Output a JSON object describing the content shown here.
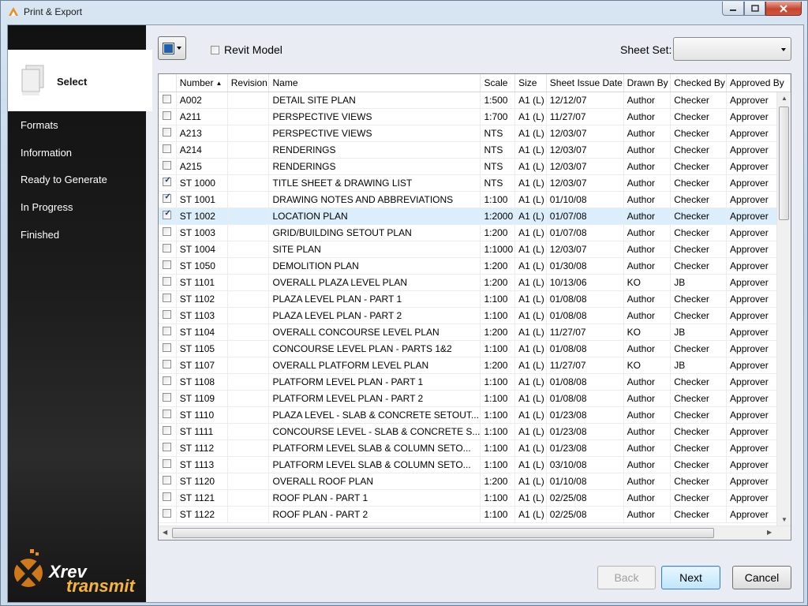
{
  "window": {
    "title": "Print & Export"
  },
  "sidebar": {
    "current_step": "Select",
    "steps": [
      "Formats",
      "Information",
      "Ready to Generate",
      "In Progress",
      "Finished"
    ],
    "logo": {
      "line1": "Xrev",
      "line2": "transmit"
    }
  },
  "toolbar": {
    "revit_model_label": "Revit Model",
    "revit_model_checked": false,
    "sheet_set_label": "Sheet Set:",
    "sheet_set_value": ""
  },
  "grid": {
    "columns": [
      "",
      "Number",
      "Revision",
      "Name",
      "Scale",
      "Size",
      "Sheet Issue Date",
      "Drawn By",
      "Checked By",
      "Approved By"
    ],
    "sort_column": "Number",
    "rows": [
      {
        "checked": false,
        "number": "A002",
        "revision": "",
        "name": "DETAIL SITE PLAN",
        "scale": "1:500",
        "size": "A1 (L)",
        "date": "12/12/07",
        "drawn": "Author",
        "checked_by": "Checker",
        "approved": "Approver"
      },
      {
        "checked": false,
        "number": "A211",
        "revision": "",
        "name": "PERSPECTIVE VIEWS",
        "scale": "1:700",
        "size": "A1 (L)",
        "date": "11/27/07",
        "drawn": "Author",
        "checked_by": "Checker",
        "approved": "Approver"
      },
      {
        "checked": false,
        "number": "A213",
        "revision": "",
        "name": "PERSPECTIVE VIEWS",
        "scale": "NTS",
        "size": "A1 (L)",
        "date": "12/03/07",
        "drawn": "Author",
        "checked_by": "Checker",
        "approved": "Approver"
      },
      {
        "checked": false,
        "number": "A214",
        "revision": "",
        "name": "RENDERINGS",
        "scale": "NTS",
        "size": "A1 (L)",
        "date": "12/03/07",
        "drawn": "Author",
        "checked_by": "Checker",
        "approved": "Approver"
      },
      {
        "checked": false,
        "number": "A215",
        "revision": "",
        "name": "RENDERINGS",
        "scale": "NTS",
        "size": "A1 (L)",
        "date": "12/03/07",
        "drawn": "Author",
        "checked_by": "Checker",
        "approved": "Approver"
      },
      {
        "checked": true,
        "number": "ST 1000",
        "revision": "",
        "name": "TITLE SHEET & DRAWING LIST",
        "scale": "NTS",
        "size": "A1 (L)",
        "date": "12/03/07",
        "drawn": "Author",
        "checked_by": "Checker",
        "approved": "Approver"
      },
      {
        "checked": true,
        "number": "ST 1001",
        "revision": "",
        "name": "DRAWING NOTES AND ABBREVIATIONS",
        "scale": "1:100",
        "size": "A1 (L)",
        "date": "01/10/08",
        "drawn": "Author",
        "checked_by": "Checker",
        "approved": "Approver"
      },
      {
        "checked": true,
        "selected": true,
        "number": "ST 1002",
        "revision": "",
        "name": "LOCATION PLAN",
        "scale": "1:2000",
        "size": "A1 (L)",
        "date": "01/07/08",
        "drawn": "Author",
        "checked_by": "Checker",
        "approved": "Approver"
      },
      {
        "checked": false,
        "number": "ST 1003",
        "revision": "",
        "name": "GRID/BUILDING SETOUT PLAN",
        "scale": "1:200",
        "size": "A1 (L)",
        "date": "01/07/08",
        "drawn": "Author",
        "checked_by": "Checker",
        "approved": "Approver"
      },
      {
        "checked": false,
        "number": "ST 1004",
        "revision": "",
        "name": "SITE PLAN",
        "scale": "1:1000",
        "size": "A1 (L)",
        "date": "12/03/07",
        "drawn": "Author",
        "checked_by": "Checker",
        "approved": "Approver"
      },
      {
        "checked": false,
        "number": "ST 1050",
        "revision": "",
        "name": "DEMOLITION PLAN",
        "scale": "1:200",
        "size": "A1 (L)",
        "date": "01/30/08",
        "drawn": "Author",
        "checked_by": "Checker",
        "approved": "Approver"
      },
      {
        "checked": false,
        "number": "ST 1101",
        "revision": "",
        "name": "OVERALL PLAZA LEVEL PLAN",
        "scale": "1:200",
        "size": "A1 (L)",
        "date": "10/13/06",
        "drawn": "KO",
        "checked_by": "JB",
        "approved": "Approver"
      },
      {
        "checked": false,
        "number": "ST 1102",
        "revision": "",
        "name": "PLAZA LEVEL PLAN - PART 1",
        "scale": "1:100",
        "size": "A1 (L)",
        "date": "01/08/08",
        "drawn": "Author",
        "checked_by": "Checker",
        "approved": "Approver"
      },
      {
        "checked": false,
        "number": "ST 1103",
        "revision": "",
        "name": "PLAZA LEVEL PLAN - PART 2",
        "scale": "1:100",
        "size": "A1 (L)",
        "date": "01/08/08",
        "drawn": "Author",
        "checked_by": "Checker",
        "approved": "Approver"
      },
      {
        "checked": false,
        "number": "ST 1104",
        "revision": "",
        "name": "OVERALL CONCOURSE LEVEL PLAN",
        "scale": "1:200",
        "size": "A1 (L)",
        "date": "11/27/07",
        "drawn": "KO",
        "checked_by": "JB",
        "approved": "Approver"
      },
      {
        "checked": false,
        "number": "ST 1105",
        "revision": "",
        "name": "CONCOURSE LEVEL PLAN - PARTS 1&2",
        "scale": "1:100",
        "size": "A1 (L)",
        "date": "01/08/08",
        "drawn": "Author",
        "checked_by": "Checker",
        "approved": "Approver"
      },
      {
        "checked": false,
        "number": "ST 1107",
        "revision": "",
        "name": "OVERALL PLATFORM LEVEL PLAN",
        "scale": "1:200",
        "size": "A1 (L)",
        "date": "11/27/07",
        "drawn": "KO",
        "checked_by": "JB",
        "approved": "Approver"
      },
      {
        "checked": false,
        "number": "ST 1108",
        "revision": "",
        "name": "PLATFORM LEVEL PLAN - PART 1",
        "scale": "1:100",
        "size": "A1 (L)",
        "date": "01/08/08",
        "drawn": "Author",
        "checked_by": "Checker",
        "approved": "Approver"
      },
      {
        "checked": false,
        "number": "ST 1109",
        "revision": "",
        "name": "PLATFORM LEVEL PLAN - PART 2",
        "scale": "1:100",
        "size": "A1 (L)",
        "date": "01/08/08",
        "drawn": "Author",
        "checked_by": "Checker",
        "approved": "Approver"
      },
      {
        "checked": false,
        "number": "ST 1110",
        "revision": "",
        "name": "PLAZA LEVEL - SLAB & CONCRETE SETOUT...",
        "scale": "1:100",
        "size": "A1 (L)",
        "date": "01/23/08",
        "drawn": "Author",
        "checked_by": "Checker",
        "approved": "Approver"
      },
      {
        "checked": false,
        "number": "ST 1111",
        "revision": "",
        "name": "CONCOURSE LEVEL - SLAB & CONCRETE S...",
        "scale": "1:100",
        "size": "A1 (L)",
        "date": "01/23/08",
        "drawn": "Author",
        "checked_by": "Checker",
        "approved": "Approver"
      },
      {
        "checked": false,
        "number": "ST 1112",
        "revision": "",
        "name": "PLATFORM LEVEL SLAB & COLUMN SETO...",
        "scale": "1:100",
        "size": "A1 (L)",
        "date": "01/23/08",
        "drawn": "Author",
        "checked_by": "Checker",
        "approved": "Approver"
      },
      {
        "checked": false,
        "number": "ST 1113",
        "revision": "",
        "name": "PLATFORM LEVEL SLAB & COLUMN SETO...",
        "scale": "1:100",
        "size": "A1 (L)",
        "date": "03/10/08",
        "drawn": "Author",
        "checked_by": "Checker",
        "approved": "Approver"
      },
      {
        "checked": false,
        "number": "ST 1120",
        "revision": "",
        "name": "OVERALL ROOF PLAN",
        "scale": "1:200",
        "size": "A1 (L)",
        "date": "01/10/08",
        "drawn": "Author",
        "checked_by": "Checker",
        "approved": "Approver"
      },
      {
        "checked": false,
        "number": "ST 1121",
        "revision": "",
        "name": "ROOF PLAN - PART 1",
        "scale": "1:100",
        "size": "A1 (L)",
        "date": "02/25/08",
        "drawn": "Author",
        "checked_by": "Checker",
        "approved": "Approver"
      },
      {
        "checked": false,
        "number": "ST 1122",
        "revision": "",
        "name": "ROOF PLAN - PART 2",
        "scale": "1:100",
        "size": "A1 (L)",
        "date": "02/25/08",
        "drawn": "Author",
        "checked_by": "Checker",
        "approved": "Approver"
      }
    ]
  },
  "buttons": {
    "back": "Back",
    "next": "Next",
    "cancel": "Cancel"
  },
  "colors": {
    "sidebar_bg": "#1a1a1a",
    "selected_row": "#dbeefb",
    "logo_orange": "#f08a1c"
  }
}
